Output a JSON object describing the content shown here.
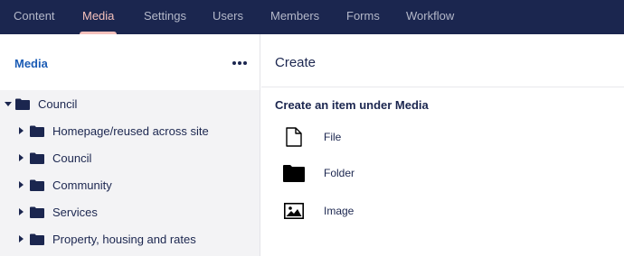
{
  "nav": {
    "tabs": [
      {
        "label": "Content",
        "active": false
      },
      {
        "label": "Media",
        "active": true
      },
      {
        "label": "Settings",
        "active": false
      },
      {
        "label": "Users",
        "active": false
      },
      {
        "label": "Members",
        "active": false
      },
      {
        "label": "Forms",
        "active": false
      },
      {
        "label": "Workflow",
        "active": false
      }
    ]
  },
  "sidebar": {
    "title": "Media",
    "more_icon": "ellipsis-icon",
    "tree": {
      "root": {
        "label": "Council",
        "expanded": true,
        "icon": "folder-icon"
      },
      "children": [
        {
          "label": "Homepage/reused across site",
          "icon": "folder-icon"
        },
        {
          "label": "Council",
          "icon": "folder-icon"
        },
        {
          "label": "Community",
          "icon": "folder-icon"
        },
        {
          "label": "Services",
          "icon": "folder-icon"
        },
        {
          "label": "Property, housing and rates",
          "icon": "folder-icon"
        }
      ]
    }
  },
  "main": {
    "title": "Create",
    "section_title": "Create an item under Media",
    "items": [
      {
        "label": "File",
        "icon": "file-icon"
      },
      {
        "label": "Folder",
        "icon": "folder-icon"
      },
      {
        "label": "Image",
        "icon": "image-icon"
      }
    ]
  },
  "colors": {
    "nav_bg": "#1b264f",
    "nav_active": "#f5c1bc",
    "sidebar_title": "#1b5cb5",
    "text": "#1b264f"
  }
}
